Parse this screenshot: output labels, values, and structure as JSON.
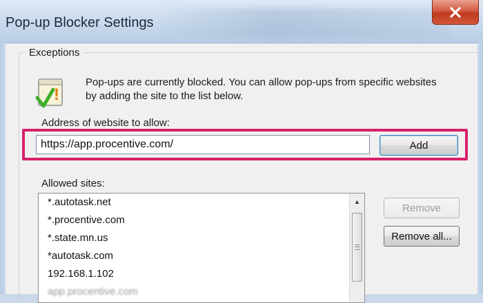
{
  "window": {
    "title": "Pop-up Blocker Settings",
    "close_icon": "close-icon"
  },
  "exceptions": {
    "group_label": "Exceptions",
    "info_icon": "warning-check-icon",
    "info_text": "Pop-ups are currently blocked.  You can allow pop-ups from specific websites by adding the site to the list below.",
    "address_label": "Address of website to allow:",
    "address_value": "https://app.procentive.com/",
    "add_label": "Add",
    "allowed_label": "Allowed sites:",
    "allowed_sites": [
      "*.autotask.net",
      "*.procentive.com",
      "*.state.mn.us",
      "*autotask.com",
      "192.168.1.102",
      "app.procentive.com"
    ],
    "remove_label": "Remove",
    "remove_all_label": "Remove all..."
  },
  "colors": {
    "highlight": "#d8206a",
    "close_button": "#c8452a"
  }
}
